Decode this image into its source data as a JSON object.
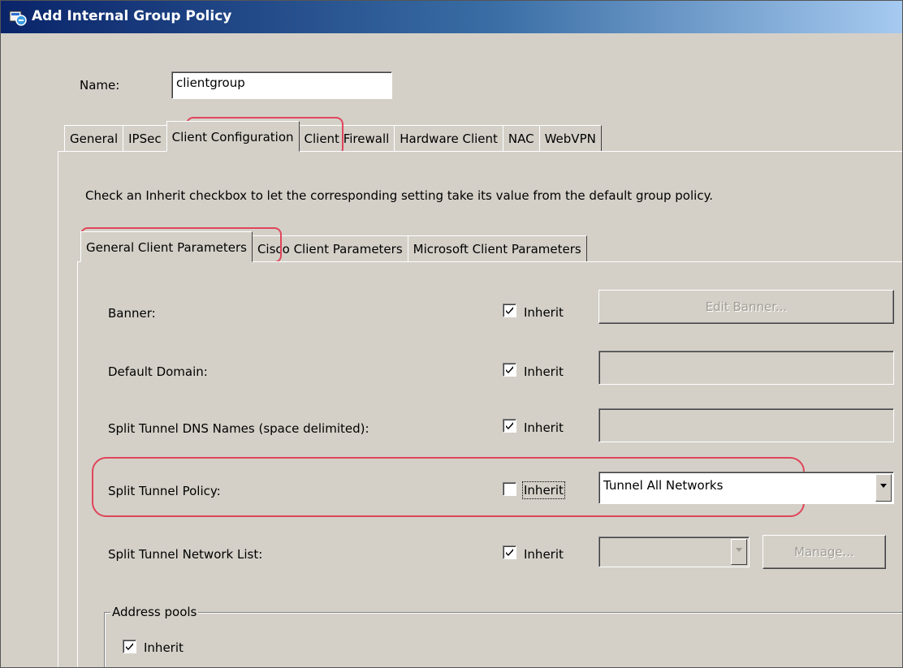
{
  "window": {
    "title": "Add Internal Group Policy"
  },
  "name_field": {
    "label": "Name:",
    "value": "clientgroup"
  },
  "main_tabs": [
    "General",
    "IPSec",
    "Client Configuration",
    "Client Firewall",
    "Hardware Client",
    "NAC",
    "WebVPN"
  ],
  "active_main_tab": "Client Configuration",
  "instruction": "Check an Inherit checkbox to let the corresponding setting take its value from the default group policy.",
  "sub_tabs": [
    "General Client Parameters",
    "Cisco Client Parameters",
    "Microsoft Client Parameters"
  ],
  "active_sub_tab": "General Client Parameters",
  "rows": {
    "banner": {
      "label": "Banner:",
      "inherit_label": "Inherit",
      "inherit": true,
      "button": "Edit Banner..."
    },
    "default_domain": {
      "label": "Default Domain:",
      "inherit_label": "Inherit",
      "inherit": true,
      "value": ""
    },
    "split_dns": {
      "label": "Split Tunnel DNS Names (space delimited):",
      "inherit_label": "Inherit",
      "inherit": true,
      "value": ""
    },
    "split_policy": {
      "label": "Split Tunnel Policy:",
      "inherit_label": "Inherit",
      "inherit": false,
      "value": "Tunnel All Networks"
    },
    "split_list": {
      "label": "Split Tunnel Network List:",
      "inherit_label": "Inherit",
      "inherit": true,
      "value": "",
      "button": "Manage..."
    }
  },
  "address_pools": {
    "legend": "Address pools",
    "inherit_label": "Inherit",
    "inherit": true
  },
  "colors": {
    "highlight": "#e0455a",
    "dialog": "#d4d0c8",
    "titlebar": "#0a246a"
  },
  "icons": [
    "app-icon",
    "checkmark-icon",
    "dropdown-arrow-icon"
  ]
}
